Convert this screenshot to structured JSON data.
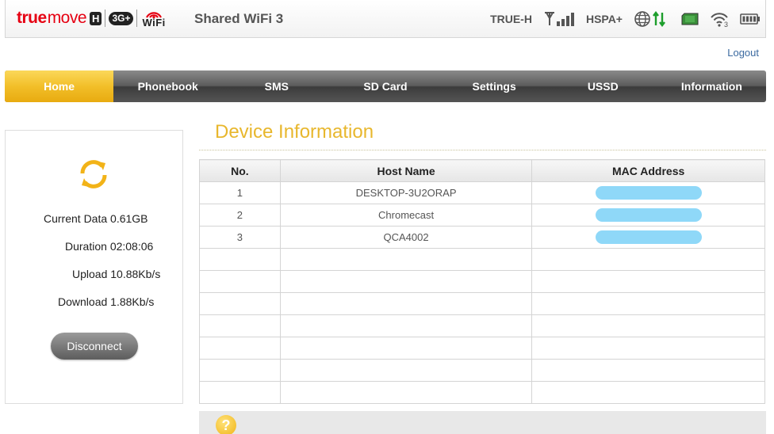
{
  "brand": {
    "logo_true": "true",
    "logo_move": "move",
    "logo_h": "H",
    "logo_3g": "3G+",
    "logo_wifi": "WiFi"
  },
  "banner": {
    "title": "Shared WiFi 3",
    "operator": "TRUE-H",
    "network_type": "HSPA+",
    "wifi_clients": "3",
    "icons": [
      "signal-bars-icon",
      "globe-icon",
      "data-arrows-icon",
      "sim-card-icon",
      "wifi-icon",
      "battery-icon"
    ]
  },
  "header": {
    "logout": "Logout"
  },
  "nav": {
    "items": [
      "Home",
      "Phonebook",
      "SMS",
      "SD Card",
      "Settings",
      "USSD",
      "Information"
    ],
    "active": "Home"
  },
  "stats": {
    "current_data_label": "Current Data",
    "current_data": "0.61GB",
    "duration_label": "Duration",
    "duration": "02:08:06",
    "upload_label": "Upload",
    "upload": "10.88Kb/s",
    "download_label": "Download",
    "download": "1.88Kb/s",
    "disconnect": "Disconnect"
  },
  "device_info": {
    "title": "Device Information",
    "columns": [
      "No.",
      "Host Name",
      "MAC Address"
    ],
    "rows": [
      {
        "no": "1",
        "host": "DESKTOP-3U2ORAP",
        "mac_redacted": true
      },
      {
        "no": "2",
        "host": "Chromecast",
        "mac_redacted": true
      },
      {
        "no": "3",
        "host": "QCA4002",
        "mac_redacted": true
      }
    ],
    "empty_rows": 7
  },
  "help": {
    "icon": "help-icon",
    "symbol": "?"
  },
  "colors": {
    "accent": "#e8b72d",
    "brand_red": "#e60012",
    "redaction": "#8fd8f8"
  }
}
